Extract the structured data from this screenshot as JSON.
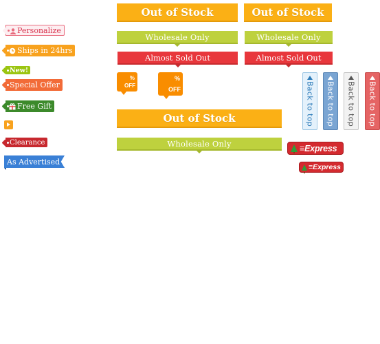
{
  "left_tags": {
    "personalize": "Personalize",
    "ships": "Ships in 24hrs",
    "new": "New!",
    "special_offer": "Special Offer",
    "free_gift": "Free Gift",
    "clearance": "Clearance",
    "as_advertised": "As Advertised"
  },
  "banners": {
    "out_of_stock": "Out of Stock",
    "wholesale_only": "Wholesale Only",
    "almost_sold_out": "Almost Sold Out"
  },
  "percent_off": {
    "symbol": "%",
    "off": "OFF"
  },
  "back_to_top": "Back to top",
  "express": "Express",
  "colors": {
    "orange": "#fbb015",
    "green": "#bed13e",
    "red": "#e8373c",
    "pink_tag": "#fdeef1",
    "orange_tag": "#f8a21e",
    "lime_tag": "#9bc511",
    "coral_tag": "#f26b38",
    "green_tag": "#3c8a2b",
    "crimson_tag": "#c7282e",
    "blue_tag": "#3a80d6"
  }
}
